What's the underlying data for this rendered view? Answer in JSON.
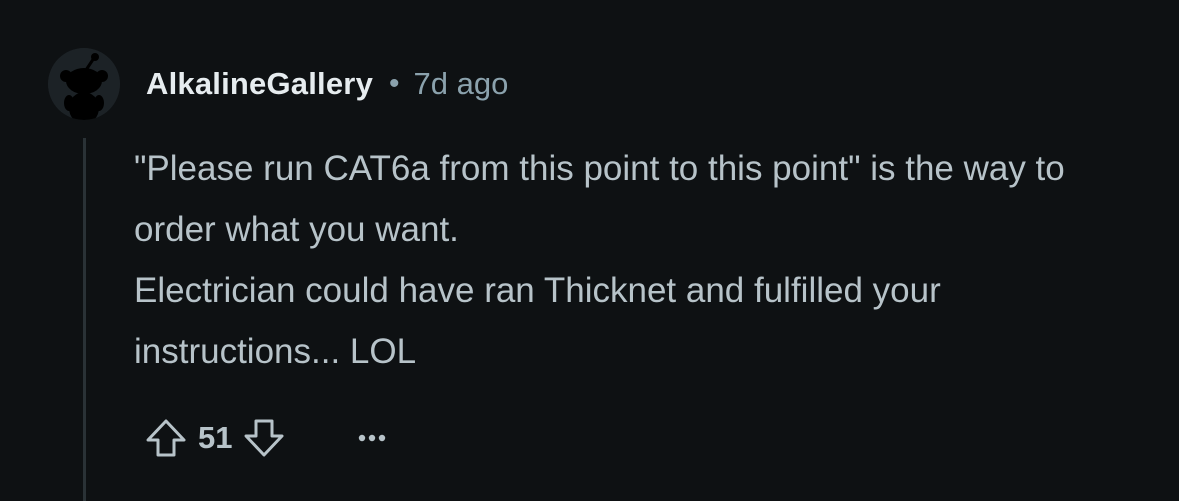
{
  "comment": {
    "author": "AlkalineGallery",
    "separator": "•",
    "timestamp": "7d ago",
    "body_lines": [
      "\"Please run CAT6a from this point to this point\" is the way to order what you want.",
      "Electrician could have ran Thicknet and fulfilled your instructions... LOL"
    ],
    "score": "51"
  },
  "colors": {
    "background": "#0e1113",
    "text": "#b7c3c9",
    "username": "#e6ecef",
    "meta": "#8ba2ad",
    "thread_line": "#2a3236"
  },
  "icons": {
    "avatar": "snoo-avatar-icon",
    "upvote": "arrow-up-icon",
    "downvote": "arrow-down-icon",
    "more": "ellipsis-icon"
  }
}
